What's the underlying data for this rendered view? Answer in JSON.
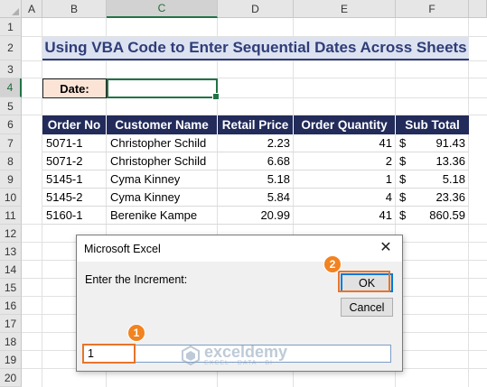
{
  "sheet": {
    "columns": [
      "A",
      "B",
      "C",
      "D",
      "E",
      "F"
    ],
    "selected_column": "C",
    "rows": [
      "1",
      "2",
      "3",
      "4",
      "5",
      "6",
      "7",
      "8",
      "9",
      "10",
      "11",
      "12",
      "13",
      "14",
      "15",
      "16",
      "17",
      "18",
      "19",
      "20"
    ],
    "selected_row": "4"
  },
  "title": "Using VBA Code to Enter Sequential Dates Across Sheets",
  "date_label": "Date:",
  "date_value": "",
  "table": {
    "headers": [
      "Order No",
      "Customer Name",
      "Retail Price",
      "Order Quantity",
      "Sub Total"
    ],
    "rows": [
      {
        "order": "5071-1",
        "customer": "Christopher Schild",
        "price": "2.23",
        "qty": "41",
        "cur": "$",
        "sub": "91.43"
      },
      {
        "order": "5071-2",
        "customer": "Christopher Schild",
        "price": "6.68",
        "qty": "2",
        "cur": "$",
        "sub": "13.36"
      },
      {
        "order": "5145-1",
        "customer": "Cyma Kinney",
        "price": "5.18",
        "qty": "1",
        "cur": "$",
        "sub": "5.18"
      },
      {
        "order": "5145-2",
        "customer": "Cyma Kinney",
        "price": "5.84",
        "qty": "4",
        "cur": "$",
        "sub": "23.36"
      },
      {
        "order": "5160-1",
        "customer": "Berenike Kampe",
        "price": "20.99",
        "qty": "41",
        "cur": "$",
        "sub": "860.59"
      }
    ]
  },
  "dialog": {
    "title": "Microsoft Excel",
    "close_glyph": "✕",
    "prompt": "Enter the Increment:",
    "ok_label": "OK",
    "cancel_label": "Cancel",
    "input_value": "1"
  },
  "badges": {
    "one": "1",
    "two": "2"
  },
  "watermark": {
    "name": "exceldemy",
    "tagline": "EXCEL · DATA · BI"
  },
  "colors": {
    "accent": "#217346",
    "title_text": "#2f3d78",
    "header_bg": "#222b5a",
    "highlight": "#e8742a"
  }
}
